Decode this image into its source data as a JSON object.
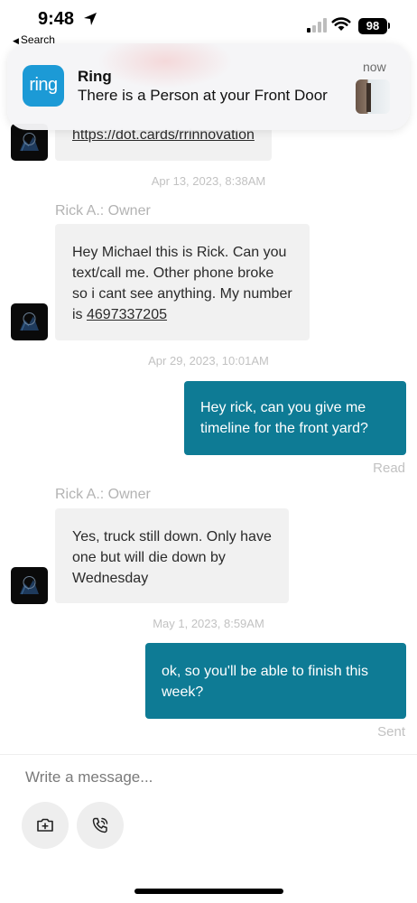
{
  "status_bar": {
    "time": "9:48",
    "back_label": "Search",
    "battery": "98"
  },
  "notification": {
    "app_logo_text": "ring",
    "app_name": "Ring",
    "message": "There is a Person at your Front Door",
    "time": "now"
  },
  "chat": {
    "messages": [
      {
        "direction": "incoming",
        "text": "https://dot.cards/rrinnovation"
      },
      {
        "timestamp": "Apr 13, 2023, 8:38AM"
      },
      {
        "sender": "Rick A.: Owner",
        "direction": "incoming",
        "lines": [
          "Hey Michael this is Rick. Can you",
          "text/call me. Other phone broke",
          "so i cant see anything. My number"
        ],
        "line4_prefix": "is ",
        "phone": "4697337205"
      },
      {
        "timestamp": "Apr 29, 2023, 10:01AM"
      },
      {
        "direction": "outgoing",
        "lines": [
          "Hey rick, can you give me",
          "timeline for the front yard?"
        ],
        "receipt": "Read"
      },
      {
        "sender": "Rick A.: Owner",
        "direction": "incoming",
        "lines": [
          "Yes, truck still down. Only have",
          "one but will die down by",
          "Wednesday"
        ]
      },
      {
        "timestamp": "May 1, 2023, 8:59AM"
      },
      {
        "direction": "outgoing",
        "lines": [
          "ok, so you'll be able to finish this",
          "week?"
        ],
        "receipt": "Sent"
      }
    ]
  },
  "composer": {
    "placeholder": "Write a message..."
  },
  "icons": {
    "location": "location-arrow-icon",
    "signal": "cellular-signal-icon",
    "wifi": "wifi-icon",
    "avatar": "avatar-logo-icon",
    "camera": "camera-add-icon",
    "call": "phone-call-icon"
  },
  "colors": {
    "outgoing_bubble": "#0e7b95",
    "incoming_bubble": "#f1f1f1",
    "ring_brand": "#1c9ad6"
  }
}
